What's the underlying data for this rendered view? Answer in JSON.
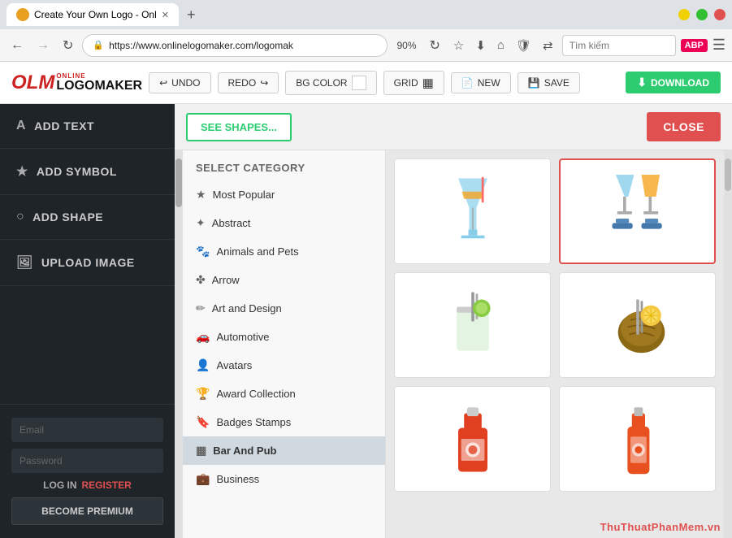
{
  "browser": {
    "tab_title": "Create Your Own Logo - Onl",
    "tab_icon": "●",
    "url": "https://www.onlinelogomaker.com/logomak",
    "zoom": "90%",
    "search_placeholder": "Tìm kiếm",
    "new_tab_label": "+",
    "window_min": "−",
    "window_max": "□",
    "window_close": "✕"
  },
  "app_header": {
    "logo_owl": "OLM",
    "logo_online": "ONLINE",
    "logo_maker": "LOGOMAKER",
    "undo_label": "UNDO",
    "redo_label": "REDO",
    "bg_color_label": "BG COLOR",
    "grid_label": "GRID",
    "new_label": "NEW",
    "save_label": "SAVE",
    "download_label": "DOWNLOAD"
  },
  "sidebar": {
    "add_text_label": "ADD TEXT",
    "add_symbol_label": "ADD SYMBOL",
    "add_shape_label": "ADD SHAPE",
    "upload_image_label": "UPLOAD IMAGE",
    "email_placeholder": "Email",
    "password_placeholder": "Password",
    "login_label": "LOG IN",
    "register_label": "REGISTER",
    "premium_label": "BECOME PREMIUM"
  },
  "shapes_toolbar": {
    "see_shapes_label": "SEE SHAPES...",
    "close_label": "CLOSE"
  },
  "categories": {
    "header": "SELECT CATEGORY",
    "items": [
      {
        "id": "most-popular",
        "label": "Most Popular",
        "icon": "★"
      },
      {
        "id": "abstract",
        "label": "Abstract",
        "icon": "✦"
      },
      {
        "id": "animals-pets",
        "label": "Animals and Pets",
        "icon": "🐾"
      },
      {
        "id": "arrow",
        "label": "Arrow",
        "icon": "✤"
      },
      {
        "id": "art-design",
        "label": "Art and Design",
        "icon": "✏"
      },
      {
        "id": "automotive",
        "label": "Automotive",
        "icon": "🚗"
      },
      {
        "id": "avatars",
        "label": "Avatars",
        "icon": "👤"
      },
      {
        "id": "award-collection",
        "label": "Award Collection",
        "icon": "🏆"
      },
      {
        "id": "badges-stamps",
        "label": "Badges Stamps",
        "icon": "🔖"
      },
      {
        "id": "bar-and-pub",
        "label": "Bar And Pub",
        "icon": "▦",
        "active": true
      },
      {
        "id": "business",
        "label": "Business",
        "icon": "💼"
      }
    ]
  },
  "watermark": {
    "text1": "ThuThuatPhanMem",
    "text2": ".vn"
  }
}
